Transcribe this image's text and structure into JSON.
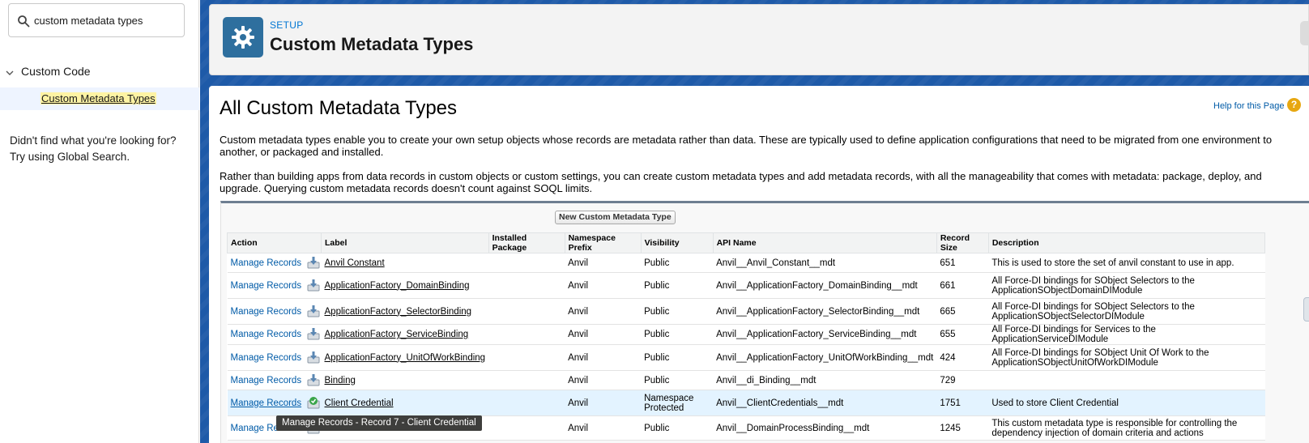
{
  "sidebar": {
    "search_value": "custom metadata types",
    "group_label": "Custom Code",
    "item_label": "Custom Metadata Types",
    "help_line1": "Didn't find what you're looking for?",
    "help_line2": "Try using Global Search."
  },
  "header": {
    "breadcrumb": "SETUP",
    "title": "Custom Metadata Types"
  },
  "content": {
    "title": "All Custom Metadata Types",
    "help_link": "Help for this Page",
    "help_icon": "?",
    "desc1": "Custom metadata types enable you to create your own setup objects whose records are metadata rather than data. These are typically used to define application configurations that need to be migrated from one environment to another, or packaged and installed.",
    "desc2": "Rather than building apps from data records in custom objects or custom settings, you can create custom metadata types and add metadata records, with all the manageability that comes with metadata: package, deploy, and upgrade. Querying custom metadata records doesn't count against SOQL limits.",
    "new_button": "New Custom Metadata Type"
  },
  "table": {
    "headers": {
      "action": "Action",
      "label": "Label",
      "installed": "Installed Package",
      "namespace": "Namespace Prefix",
      "visibility": "Visibility",
      "api": "API Name",
      "size": "Record Size",
      "description": "Description"
    },
    "rows": [
      {
        "action": "Manage Records",
        "label": "Anvil Constant",
        "installed": "",
        "namespace": "Anvil",
        "visibility": "Public",
        "api": "Anvil__Anvil_Constant__mdt",
        "size": "651",
        "description": "This is used to store the set of anvil constant to use in app."
      },
      {
        "action": "Manage Records",
        "label": "ApplicationFactory_DomainBinding",
        "installed": "",
        "namespace": "Anvil",
        "visibility": "Public",
        "api": "Anvil__ApplicationFactory_DomainBinding__mdt",
        "size": "661",
        "description": "All Force-DI bindings for SObject Selectors to the ApplicationSObjectDomainDIModule"
      },
      {
        "action": "Manage Records",
        "label": "ApplicationFactory_SelectorBinding",
        "installed": "",
        "namespace": "Anvil",
        "visibility": "Public",
        "api": "Anvil__ApplicationFactory_SelectorBinding__mdt",
        "size": "665",
        "description": "All Force-DI bindings for SObject Selectors to the ApplicationSObjectSelectorDIModule"
      },
      {
        "action": "Manage Records",
        "label": "ApplicationFactory_ServiceBinding",
        "installed": "",
        "namespace": "Anvil",
        "visibility": "Public",
        "api": "Anvil__ApplicationFactory_ServiceBinding__mdt",
        "size": "655",
        "description": "All Force-DI bindings for Services to the ApplicationServiceDIModule"
      },
      {
        "action": "Manage Records",
        "label": "ApplicationFactory_UnitOfWorkBinding",
        "installed": "",
        "namespace": "Anvil",
        "visibility": "Public",
        "api": "Anvil__ApplicationFactory_UnitOfWorkBinding__mdt",
        "size": "424",
        "description": "All Force-DI bindings for SObject Unit Of Work to the ApplicationSObjectUnitOfWorkDIModule"
      },
      {
        "action": "Manage Records",
        "label": "Binding",
        "installed": "",
        "namespace": "Anvil",
        "visibility": "Public",
        "api": "Anvil__di_Binding__mdt",
        "size": "729",
        "description": ""
      },
      {
        "action": "Manage Records",
        "label": "Client Credential",
        "installed": "",
        "namespace": "Anvil",
        "visibility": "Namespace Protected",
        "api": "Anvil__ClientCredentials__mdt",
        "size": "1751",
        "description": "Used to store Client Credential"
      },
      {
        "action": "Manage Records",
        "label": "",
        "installed": "",
        "namespace": "Anvil",
        "visibility": "Public",
        "api": "Anvil__DomainProcessBinding__mdt",
        "size": "1245",
        "description": "This custom metadata type is responsible for controlling the dependency injection of domain criteria and actions"
      }
    ]
  },
  "tooltip": "Manage Records - Record 7 - Client Credential",
  "colors": {
    "brand_blue": "#1e5aa8",
    "link_blue": "#015ba7",
    "row_highlight": "#e3f3ff",
    "search_highlight": "#fef3a4"
  }
}
